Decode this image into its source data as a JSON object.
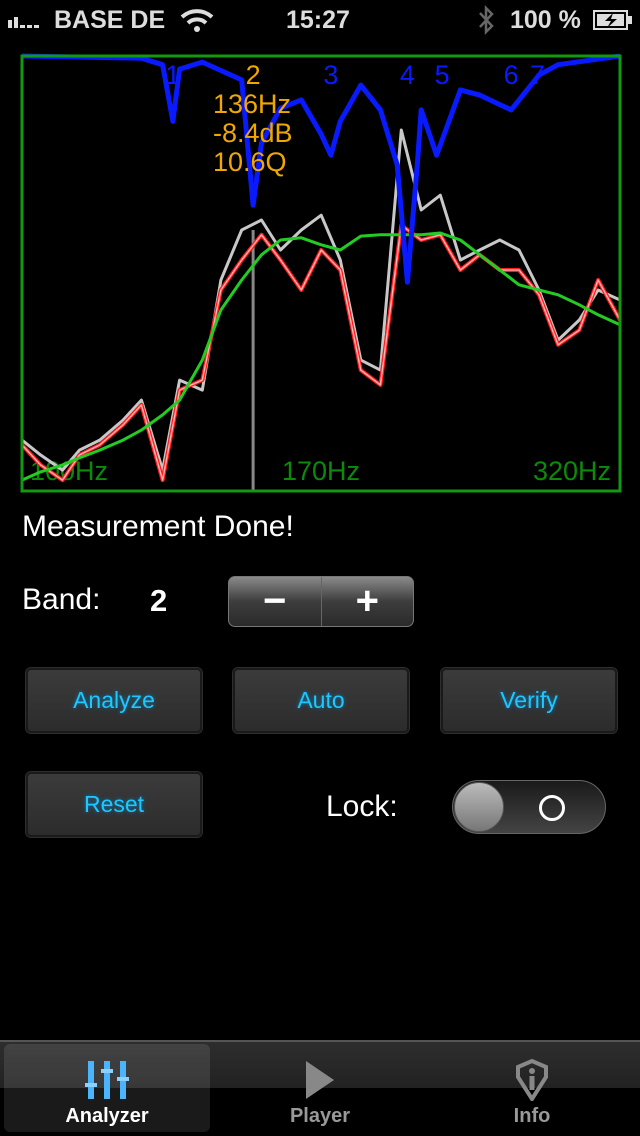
{
  "status_bar": {
    "carrier": "BASE DE",
    "time": "15:27",
    "battery": "100 %",
    "icons": [
      "signal-icon",
      "wifi-icon",
      "bluetooth-icon",
      "battery-charging-icon"
    ]
  },
  "chart_data": {
    "type": "line",
    "x_scale": "log",
    "xlim": [
      96,
      360
    ],
    "ylim": [
      0,
      100
    ],
    "grid": false,
    "x_tick_labels": [
      {
        "f": 100,
        "label": "100Hz"
      },
      {
        "f": 170,
        "label": "170Hz"
      },
      {
        "f": 320,
        "label": "320Hz"
      }
    ],
    "selected_band": {
      "number": "2",
      "freq": 160,
      "info": [
        "136Hz",
        "-8.4dB",
        "10.6Q"
      ]
    },
    "bands": [
      {
        "label": "1",
        "f": 134
      },
      {
        "label": "2",
        "f": 160
      },
      {
        "label": "3",
        "f": 190
      },
      {
        "label": "4",
        "f": 225
      },
      {
        "label": "5",
        "f": 243
      },
      {
        "label": "6",
        "f": 283
      },
      {
        "label": "7",
        "f": 300
      }
    ],
    "x": [
      96,
      100,
      105,
      109,
      114,
      120,
      125,
      131,
      136,
      143,
      149,
      156,
      163,
      170,
      178,
      186,
      194,
      203,
      212,
      222,
      232,
      242,
      253,
      264,
      276,
      288,
      301,
      314,
      329,
      343,
      360
    ],
    "series": [
      {
        "color": "#c8c8c8",
        "values": [
          11.7,
          8.3,
          4.8,
          9.4,
          11.7,
          16.3,
          20.9,
          4.8,
          25.5,
          23.2,
          48.5,
          60,
          62.3,
          55.4,
          60,
          63.4,
          53.1,
          30.1,
          27.8,
          83,
          64.6,
          68,
          53.1,
          55.4,
          57.7,
          55.4,
          46.2,
          34.7,
          39.3,
          46.2,
          43.9
        ]
      },
      {
        "color": "#ff1a1a",
        "values": [
          10.6,
          6,
          2.5,
          8.3,
          10.6,
          15.2,
          19.8,
          2.5,
          23.2,
          25.5,
          46.2,
          53.1,
          58.9,
          53.1,
          46.2,
          55.4,
          50.8,
          27.8,
          24.4,
          61.1,
          57.7,
          58.9,
          50.8,
          54.3,
          50.8,
          50.8,
          45.1,
          33.6,
          37,
          48.5,
          39.3
        ]
      },
      {
        "color": "#22cc22",
        "values": [
          2.5,
          4.4,
          6,
          7.6,
          9.4,
          11.7,
          14,
          17.5,
          20.9,
          30.1,
          41.6,
          48.5,
          54.3,
          57.7,
          58.2,
          56.6,
          55.4,
          58.6,
          58.9,
          58.9,
          58.9,
          59.3,
          57.7,
          54.3,
          50.8,
          47.4,
          46.2,
          45.1,
          42.8,
          40.5,
          38.2
        ]
      }
    ],
    "eq_curve": {
      "color": "#0a1aff",
      "points": [
        [
          96,
          100
        ],
        [
          125,
          99.5
        ],
        [
          131,
          98
        ],
        [
          134,
          85
        ],
        [
          136,
          97
        ],
        [
          143,
          98.6
        ],
        [
          156,
          94.5
        ],
        [
          158,
          80
        ],
        [
          160,
          65.7
        ],
        [
          163,
          80
        ],
        [
          170,
          88
        ],
        [
          178,
          89.9
        ],
        [
          186,
          82
        ],
        [
          190,
          77.2
        ],
        [
          194,
          85
        ],
        [
          203,
          93.3
        ],
        [
          212,
          87.6
        ],
        [
          220,
          75
        ],
        [
          225,
          48
        ],
        [
          230,
          75
        ],
        [
          232,
          87.6
        ],
        [
          240,
          77.2
        ],
        [
          253,
          92.2
        ],
        [
          264,
          91
        ],
        [
          283,
          87.6
        ],
        [
          301,
          95.6
        ],
        [
          314,
          98
        ],
        [
          360,
          100
        ]
      ]
    },
    "frame_color": "#119911",
    "label_color": "#f0a800"
  },
  "main": {
    "message": "Measurement Done!",
    "band_label": "Band:",
    "band_value": "2",
    "minus": "−",
    "plus": "+",
    "buttons": {
      "analyze": "Analyze",
      "auto": "Auto",
      "verify": "Verify",
      "reset": "Reset"
    },
    "lock_label": "Lock:",
    "lock_on": false,
    "accent": "#1ec8ff"
  },
  "tabbar": {
    "tabs": [
      {
        "label": "Analyzer",
        "icon": "equalizer-icon",
        "active": true
      },
      {
        "label": "Player",
        "icon": "play-icon"
      },
      {
        "label": "Info",
        "icon": "info-shield-icon"
      }
    ]
  }
}
